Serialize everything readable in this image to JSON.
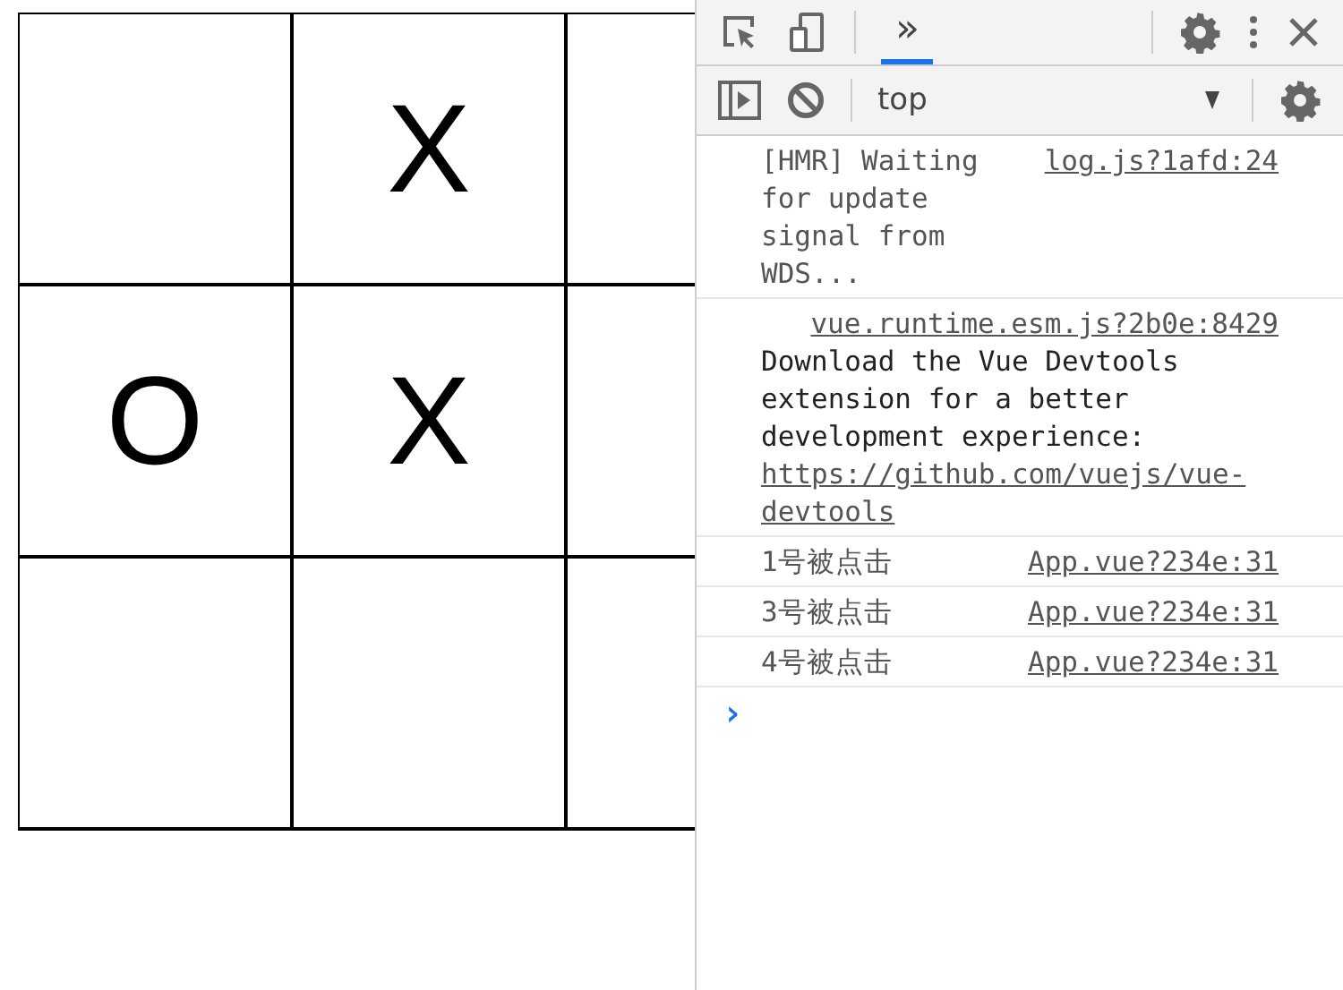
{
  "board": {
    "rows": [
      [
        {},
        {
          "mark": "X"
        },
        {}
      ],
      [
        {
          "mark": "O"
        },
        {
          "mark": "X"
        },
        {}
      ],
      [
        {},
        {},
        {}
      ]
    ]
  },
  "devtools": {
    "tabs": [
      {
        "label": "»",
        "selected": true
      }
    ],
    "context": "top",
    "messages": [
      {
        "kind": "inline",
        "text": "[HMR] Waiting for update signal from WDS...",
        "source": "log.js?1afd:24"
      },
      {
        "kind": "block",
        "text": "Download the Vue Devtools extension for a better development experience: ",
        "url": "https://github.com/vuejs/vue-devtools",
        "source": "vue.runtime.esm.js?2b0e:8429"
      },
      {
        "kind": "inline",
        "text": "1号被点击",
        "source": "App.vue?234e:31"
      },
      {
        "kind": "inline",
        "text": "3号被点击",
        "source": "App.vue?234e:31"
      },
      {
        "kind": "inline",
        "text": "4号被点击",
        "source": "App.vue?234e:31"
      }
    ],
    "prompt": "›"
  }
}
